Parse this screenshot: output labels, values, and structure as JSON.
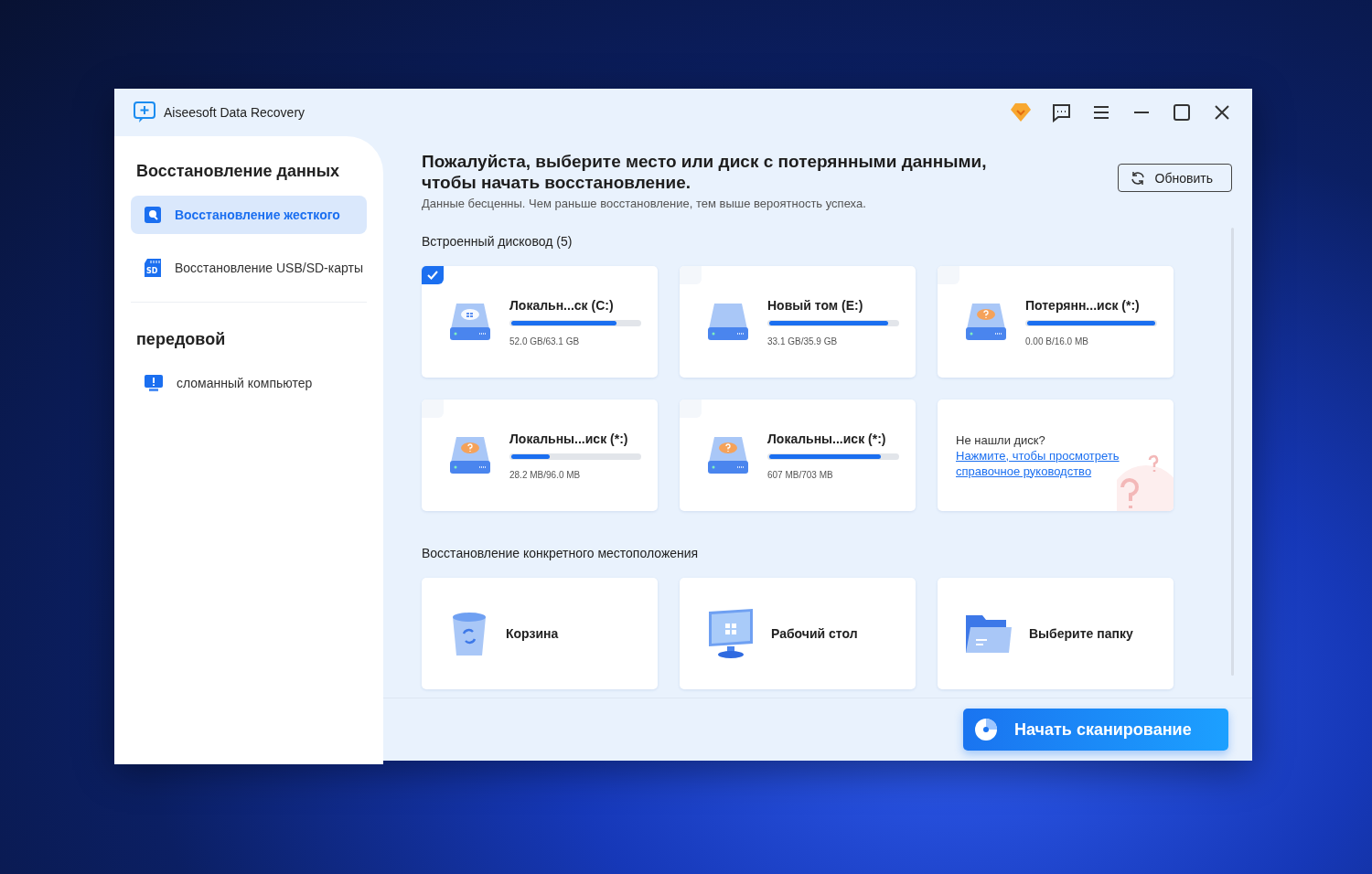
{
  "window": {
    "title": "Aiseesoft Data Recovery"
  },
  "sidebar": {
    "sections": [
      {
        "heading": "Восстановление данных",
        "items": [
          {
            "label": "Восстановление жесткого",
            "kind": "disk",
            "selected": true
          },
          {
            "label": "Восстановление USB/SD-карты",
            "kind": "sd",
            "icon_text": "SD",
            "selected": false
          }
        ]
      },
      {
        "heading": "передовой",
        "items": [
          {
            "label": "сломанный компьютер",
            "kind": "pc",
            "selected": false
          }
        ]
      }
    ]
  },
  "main": {
    "heading": "Пожалуйста, выберите место или диск с потерянными данными, чтобы начать восстановление.",
    "subtitle": "Данные бесценны. Чем раньше восстановление, тем выше вероятность успеха.",
    "refresh_button": "Обновить",
    "drives_section": {
      "title": "Встроенный дисковод (5)",
      "drives": [
        {
          "name": "Локальн...ск (C:)",
          "usage": "52.0 GB/63.1 GB",
          "level": 0.82,
          "kind": "system",
          "selected": true
        },
        {
          "name": "Новый том (E:)",
          "usage": "33.1 GB/35.9 GB",
          "level": 0.93,
          "kind": "plain",
          "selected": false
        },
        {
          "name": "Потерянн...иск (*:)",
          "usage": "0.00  B/16.0 MB",
          "level": 1,
          "kind": "unknown",
          "selected": false
        },
        {
          "name": "Локальны...иск (*:)",
          "usage": "28.2 MB/96.0 MB",
          "level": 0.3,
          "kind": "unknown",
          "selected": false
        },
        {
          "name": "Локальны...иск (*:)",
          "usage": "607 MB/703 MB",
          "level": 0.87,
          "kind": "unknown",
          "selected": false
        }
      ],
      "help": {
        "text": "Не нашли диск?",
        "link": "Нажмите, чтобы просмотреть справочное руководство"
      }
    },
    "locations_section": {
      "title": "Восстановление конкретного местоположения",
      "items": [
        {
          "label": "Корзина",
          "kind": "bin"
        },
        {
          "label": "Рабочий стол",
          "kind": "desktop"
        },
        {
          "label": "Выберите папку",
          "kind": "folder"
        }
      ]
    },
    "scan_button": "Начать сканирование"
  }
}
